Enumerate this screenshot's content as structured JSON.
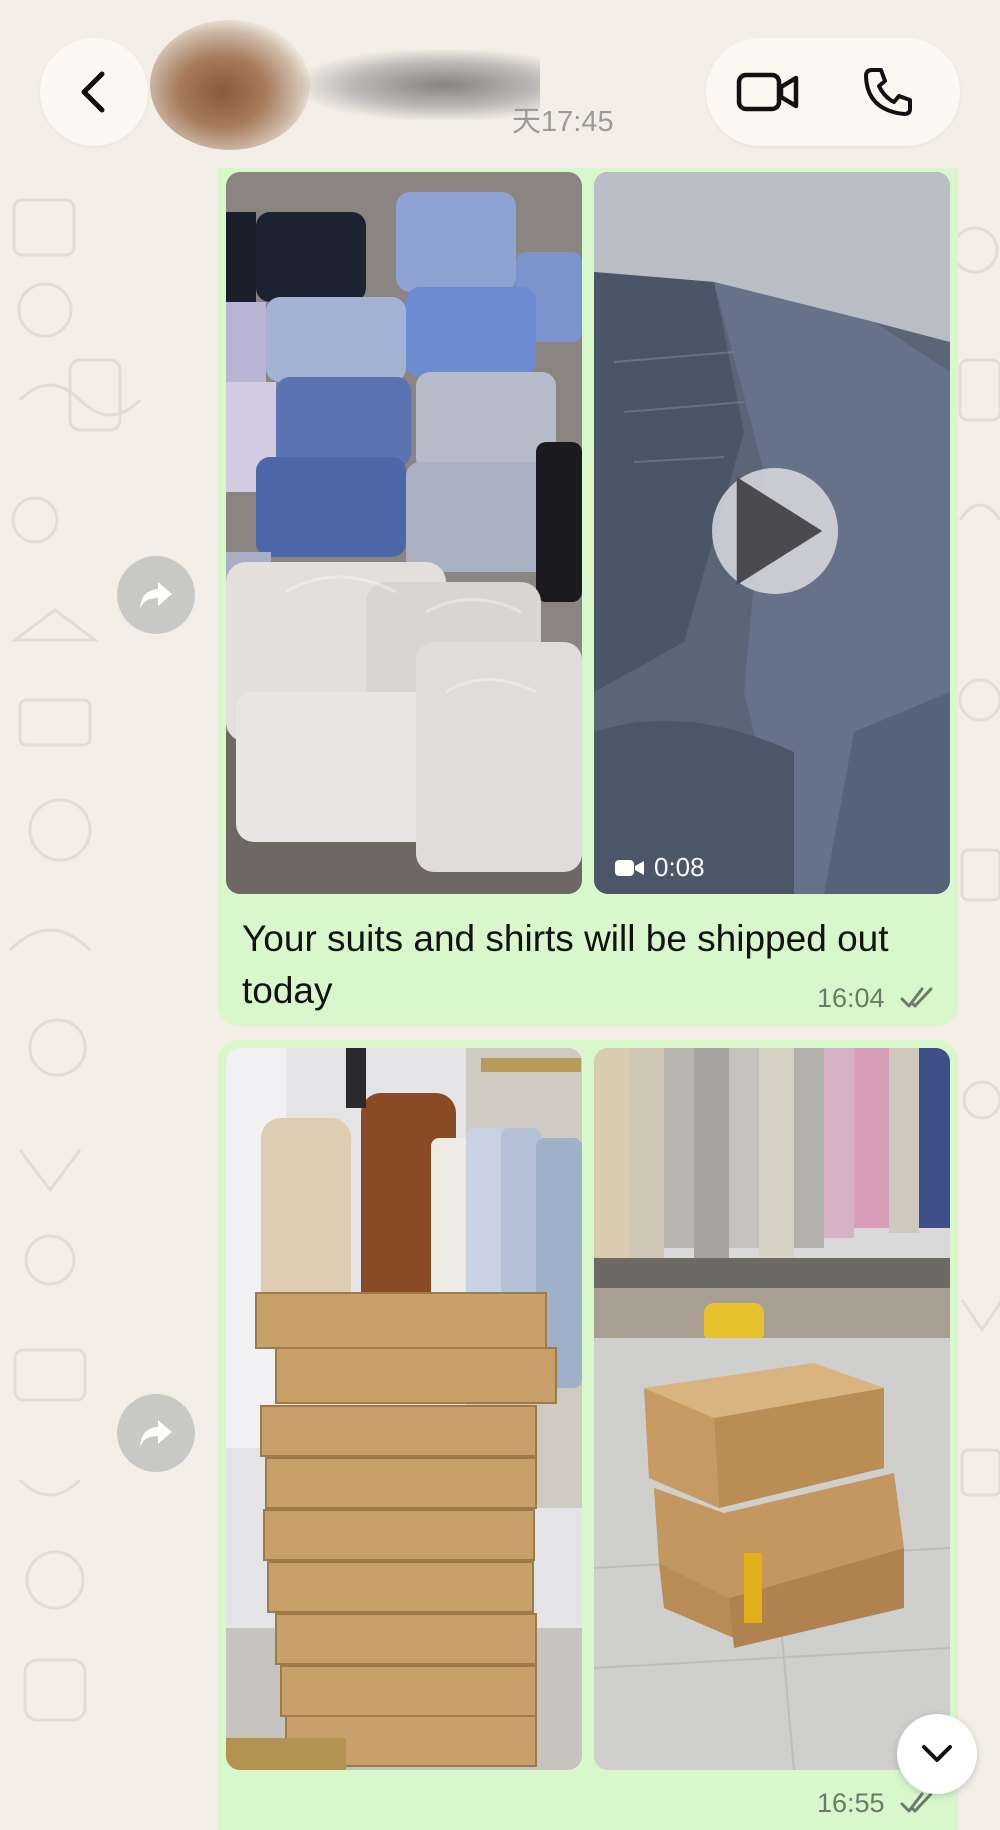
{
  "header": {
    "contact_status": "天17:45",
    "back_icon": "chevron-left-icon",
    "video_call_icon": "video-camera-icon",
    "voice_call_icon": "phone-icon"
  },
  "messages": [
    {
      "media": [
        {
          "type": "photo",
          "subject": "shirts in plastic wrap"
        },
        {
          "type": "video",
          "duration": "0:08",
          "subject": "navy suit jacket"
        }
      ],
      "text": "Your suits and shirts will be shipped out today",
      "time": "16:04",
      "status": "read"
    },
    {
      "media": [
        {
          "type": "photo",
          "subject": "stacked shipping boxes by suits"
        },
        {
          "type": "photo",
          "subject": "boxes in front of suit rack"
        }
      ],
      "text": "",
      "time": "16:55",
      "status": "read"
    }
  ],
  "colors": {
    "background": "#f3efe6",
    "outgoing_bubble": "#d8f8cc",
    "header_button": "#fbf8f1",
    "forward_button": "#c8c8c5"
  },
  "icons": {
    "forward": "forward-arrow-icon",
    "play": "play-icon",
    "scroll_down": "chevron-down-icon",
    "read_receipt": "double-check-icon"
  }
}
